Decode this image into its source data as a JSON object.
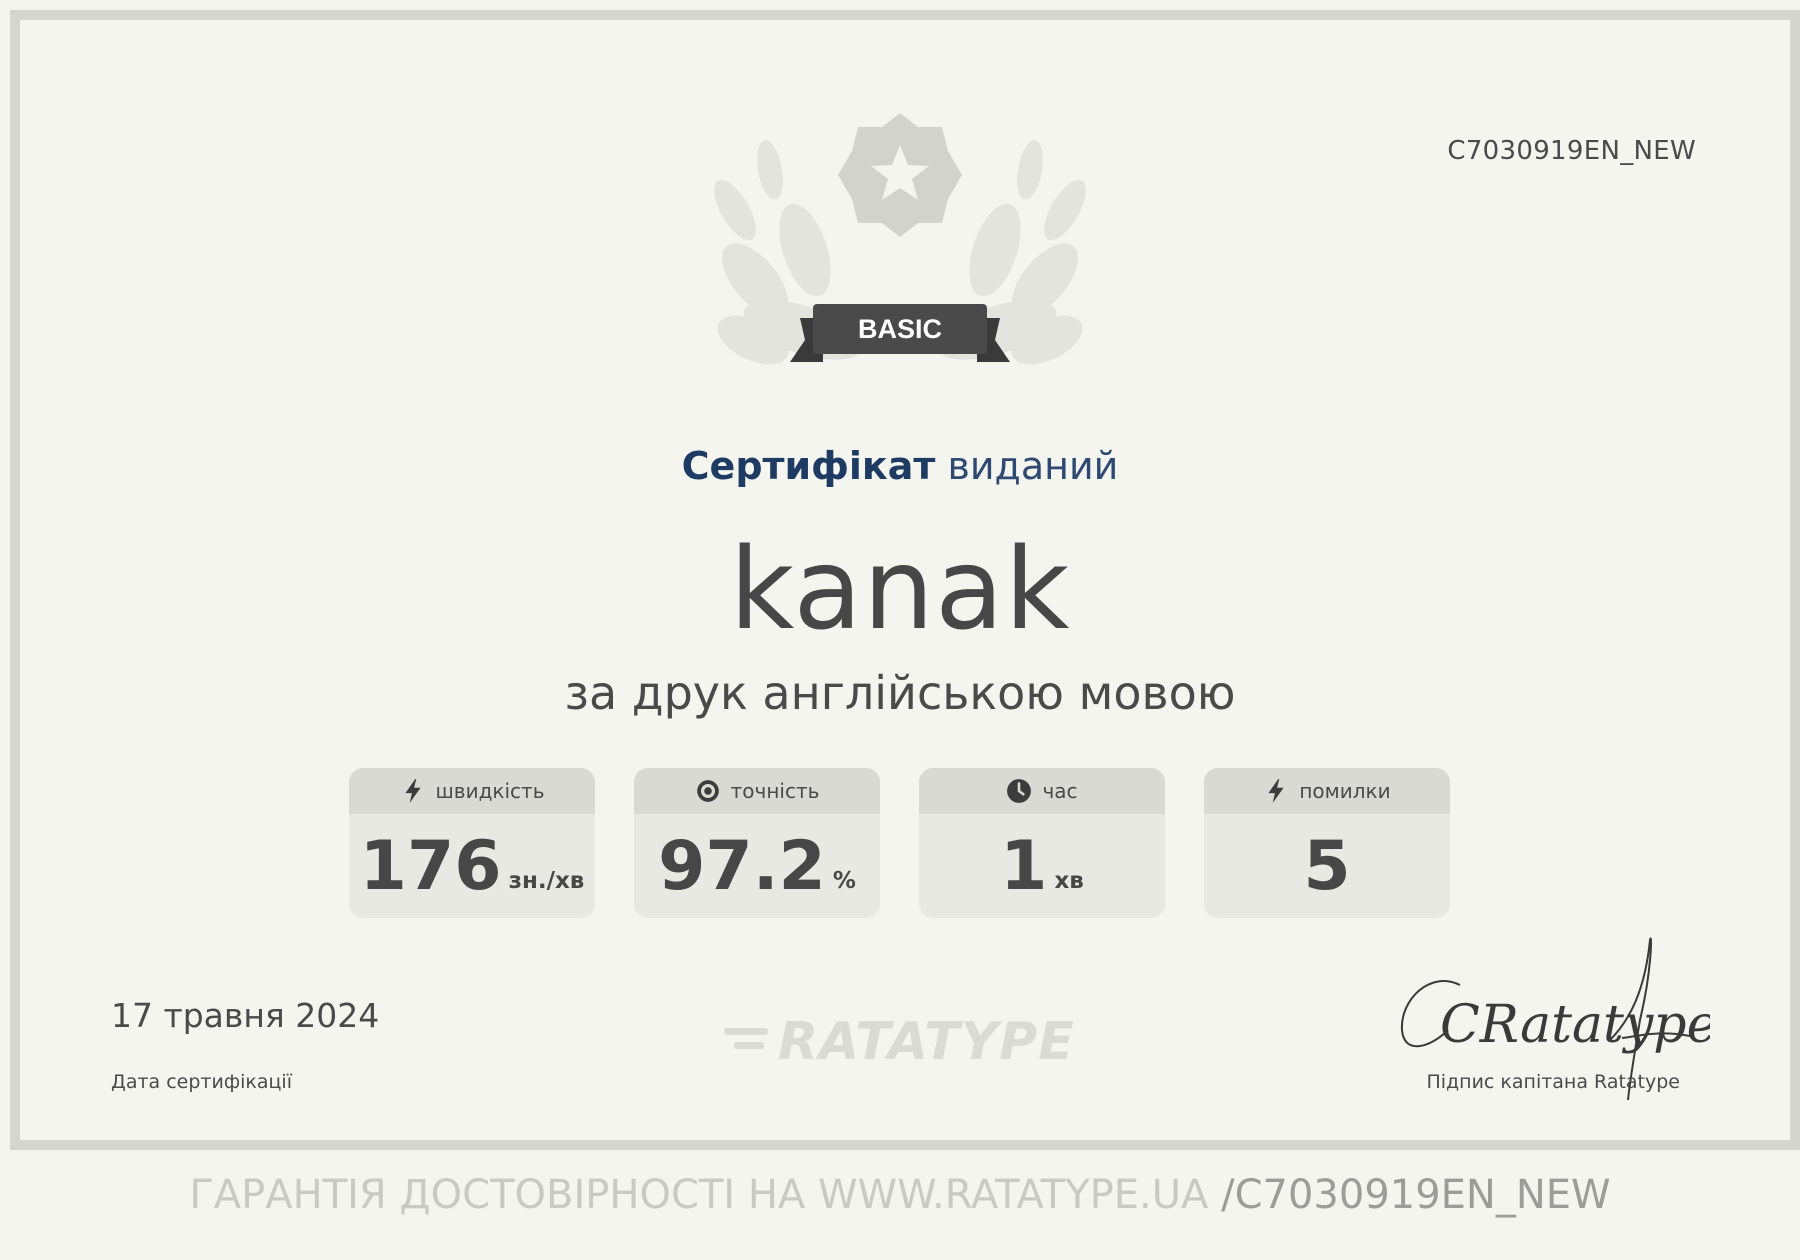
{
  "certificate": {
    "id": "C7030919EN_NEW",
    "badge_label": "BASIC",
    "heading_strong": "Сертифікат",
    "heading_light": "виданий",
    "recipient_name": "kanak",
    "subtitle": "за друк англійською мовою"
  },
  "stats": [
    {
      "label": "швидкість",
      "icon": "bolt-icon",
      "value": "176",
      "unit": "зн./хв"
    },
    {
      "label": "точність",
      "icon": "target-icon",
      "value": "97.2",
      "unit": "%"
    },
    {
      "label": "час",
      "icon": "clock-icon",
      "value": "1",
      "unit": "хв"
    },
    {
      "label": "помилки",
      "icon": "bolt-icon",
      "value": "5",
      "unit": ""
    }
  ],
  "footer_info": {
    "date": "17 травня 2024",
    "date_label": "Дата сертифікації",
    "logo_text": "RATATYPE",
    "signature_text": "CRatatype",
    "signature_label": "Підпис капітана Ratatype",
    "verify_text": "ГАРАНТІЯ ДОСТОВІРНОСТІ НА WWW.RATATYPE.UA",
    "verify_suffix": "/C7030919EN_NEW"
  },
  "colors": {
    "background": "#f4f5ef",
    "frame": "#d5d6d0",
    "heading": "#1e3b63",
    "text": "#4a4a4a"
  }
}
